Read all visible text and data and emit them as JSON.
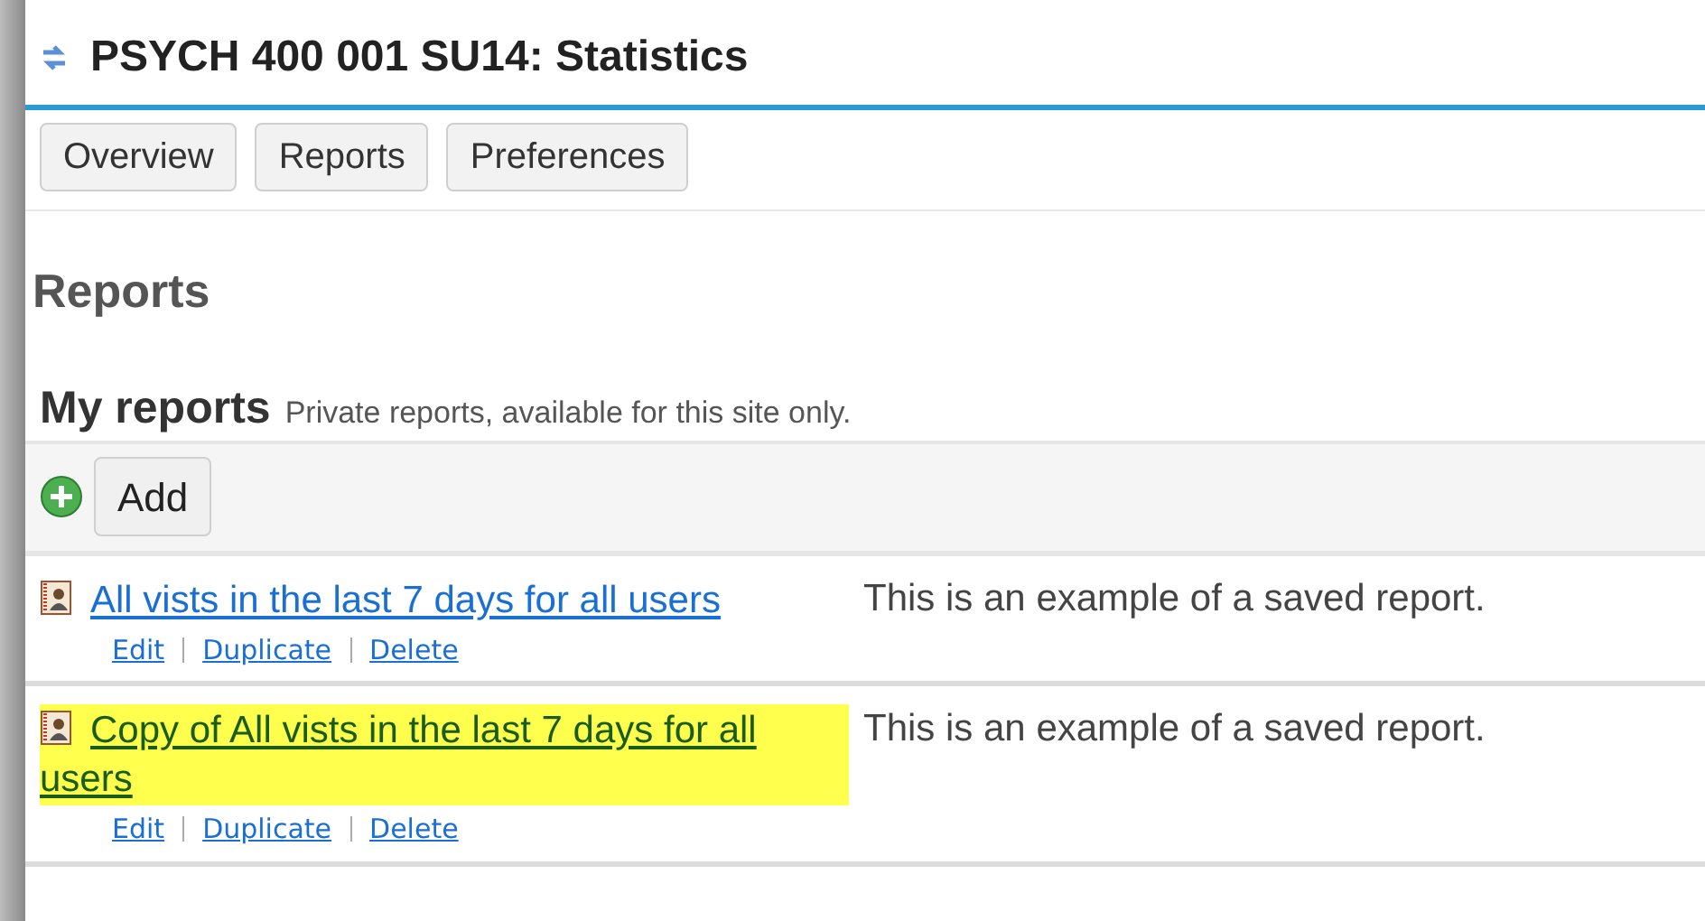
{
  "window": {
    "title": "PSYCH 400 001 SU14: Statistics"
  },
  "tabs": [
    {
      "label": "Overview",
      "selected": false
    },
    {
      "label": "Reports",
      "selected": false
    },
    {
      "label": "Preferences",
      "selected": false
    }
  ],
  "page_heading": "Reports",
  "section": {
    "title": "My reports",
    "subtitle": "Private reports, available for this site only."
  },
  "add_button": "Add",
  "reports": [
    {
      "title": "All vists in the last 7 days for all users",
      "description": "This is an example of a saved report.",
      "highlighted": false,
      "actions": [
        "Edit",
        "Duplicate",
        "Delete"
      ]
    },
    {
      "title": "Copy of All vists in the last 7 days for all users",
      "description": "This is an example of a saved report.",
      "highlighted": true,
      "actions": [
        "Edit",
        "Duplicate",
        "Delete"
      ]
    }
  ]
}
